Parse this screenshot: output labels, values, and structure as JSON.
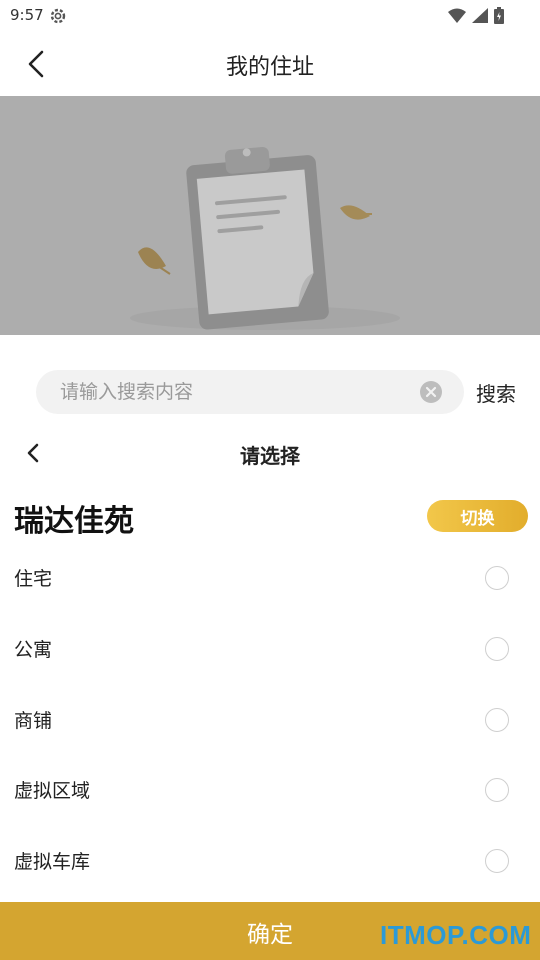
{
  "status": {
    "time": "9:57"
  },
  "appbar": {
    "title": "我的住址"
  },
  "search": {
    "placeholder": "请输入搜索内容",
    "value": "",
    "button_label": "搜索"
  },
  "picker": {
    "title": "请选择",
    "community": "瑞达佳苑",
    "switch_label": "切换",
    "options": [
      {
        "label": "住宅"
      },
      {
        "label": "公寓"
      },
      {
        "label": "商铺"
      },
      {
        "label": "虚拟区域"
      },
      {
        "label": "虚拟车库"
      }
    ],
    "confirm_label": "确定"
  },
  "watermark": "ITMOP.COM",
  "colors": {
    "accent": "#d4a530",
    "switch": "#e8b636",
    "watermark": "#2c9ad6"
  },
  "icons": {
    "status": [
      "gear-icon",
      "wifi-icon",
      "signal-icon",
      "battery-icon"
    ],
    "banner": "clipboard-illustration",
    "clear": "clear-icon",
    "back": "chevron-left-icon"
  }
}
